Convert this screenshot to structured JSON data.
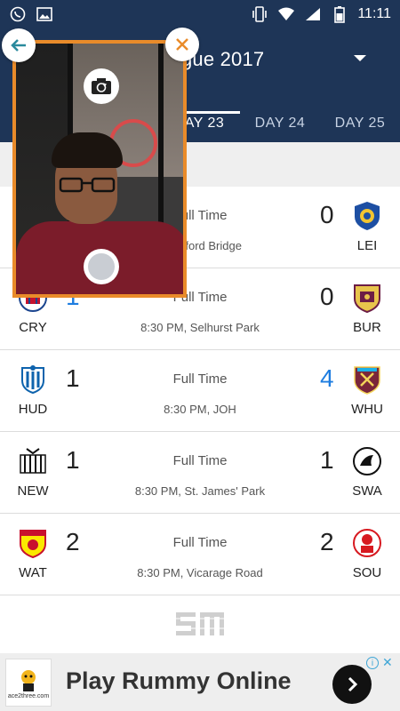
{
  "status_bar": {
    "time": "11:11",
    "left_icons": [
      "whatsapp-icon",
      "image-icon"
    ],
    "right_icons": [
      "vibrate-icon",
      "wifi-icon",
      "signal-icon",
      "battery-icon"
    ]
  },
  "header": {
    "title": "gue 2017",
    "dropdown_icon": "caret-down-icon"
  },
  "tabs": [
    {
      "label": "AY 23",
      "active": true
    },
    {
      "label": "DAY 24",
      "active": false
    },
    {
      "label": "DAY 25",
      "active": false
    }
  ],
  "matches": [
    {
      "home": "",
      "home_score": "",
      "status": "Full Time",
      "away": "LEI",
      "away_score": "0",
      "venue": "Stamford Bridge"
    },
    {
      "home": "CRY",
      "home_score": "1",
      "status": "Full Time",
      "away": "BUR",
      "away_score": "0",
      "venue": "8:30 PM, Selhurst Park"
    },
    {
      "home": "HUD",
      "home_score": "1",
      "status": "Full Time",
      "away": "WHU",
      "away_score": "4",
      "venue": "8:30 PM, JOH"
    },
    {
      "home": "NEW",
      "home_score": "1",
      "status": "Full Time",
      "away": "SWA",
      "away_score": "1",
      "venue": "8:30 PM, St. James' Park"
    },
    {
      "home": "WAT",
      "home_score": "2",
      "status": "Full Time",
      "away": "SOU",
      "away_score": "2",
      "venue": "8:30 PM, Vicarage Road"
    }
  ],
  "footer_logo": "SM",
  "ad": {
    "text": "Play Rummy Online",
    "logo_text": "ace2three.com"
  },
  "colors": {
    "header_bg": "#1e3557",
    "accent_orange": "#e98b2a",
    "win_blue": "#1e7de0"
  }
}
